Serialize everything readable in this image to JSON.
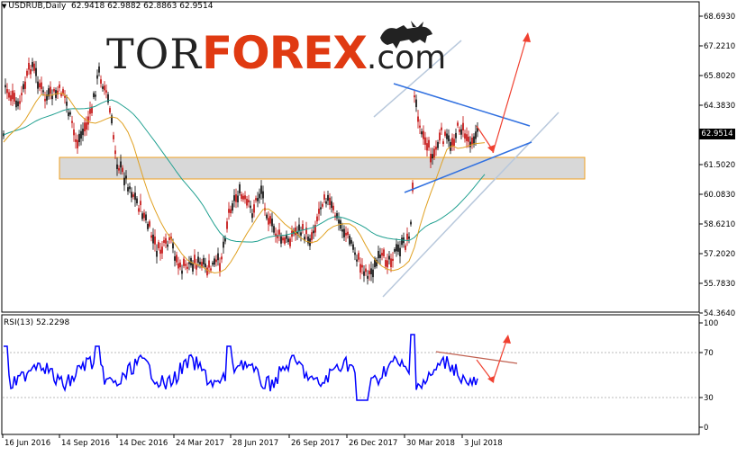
{
  "header": {
    "symbol": "USDRUB,Daily",
    "ohlc": "62.9418 62.9882 62.8863 62.9514"
  },
  "logo": {
    "tor": "TOR",
    "forex": "FOREX",
    "com": ".com"
  },
  "current_price": "62.9514",
  "price_axis": [
    "68.6930",
    "67.2210",
    "65.8020",
    "64.3830",
    "62.9514",
    "61.5020",
    "60.0830",
    "58.6210",
    "57.2020",
    "55.7830",
    "54.3640"
  ],
  "rsi": {
    "label": "RSI(13) 52.2298",
    "axis": [
      "100",
      "70",
      "30",
      "0"
    ]
  },
  "date_axis": [
    "16 Jun 2016",
    "14 Sep 2016",
    "14 Dec 2016",
    "24 Mar 2017",
    "28 Jun 2017",
    "26 Sep 2017",
    "26 Dec 2017",
    "30 Mar 2018",
    "3 Jul 2018"
  ],
  "colors": {
    "bull_candle": "#000000",
    "bear_candle": "#c00000",
    "ma_fast": "#e0a020",
    "ma_slow": "#20a090",
    "rsi_line": "#0000ff",
    "arrow": "#f04030",
    "channel": "#b0c0d8",
    "trend_line": "#3070e0",
    "zone_fill": "#d8d8d8",
    "zone_border": "#f0a020"
  }
}
